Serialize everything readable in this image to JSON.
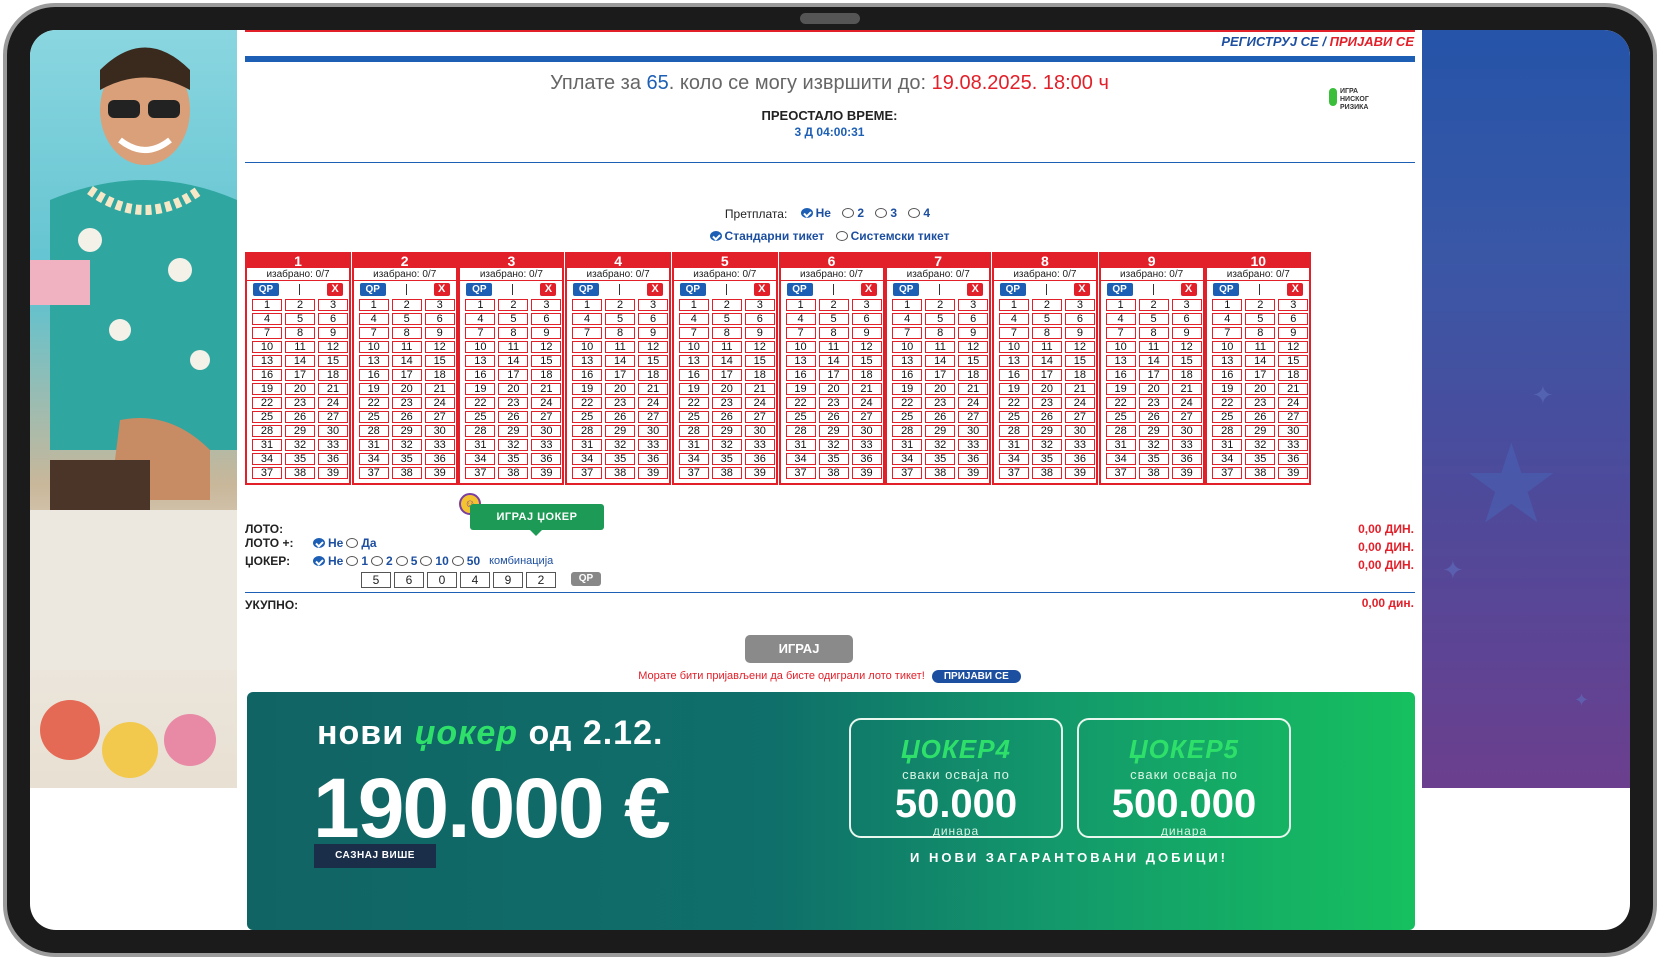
{
  "header": {
    "register_label": "РЕГИСТРУЈ СЕ",
    "separator": "/",
    "login_label": "ПРИЈАВИ СЕ"
  },
  "deadline": {
    "prefix": "Уплате за",
    "round": "65",
    "middle": ". коло се могу извршити до:",
    "datetime": "19.08.2025. 18:00 ч"
  },
  "remaining": {
    "label": "ПРЕОСТАЛО ВРЕМЕ:",
    "value": "3 Д 04:00:31"
  },
  "low_risk": {
    "line1": "ИГРА",
    "line2": "НИСКОГ",
    "line3": "РИЗИКА"
  },
  "subscription": {
    "label": "Претплата:",
    "options": [
      "Не",
      "2",
      "3",
      "4"
    ],
    "selected": "Не"
  },
  "ticket_type": {
    "options": [
      "Стандарни тикет",
      "Системски тикет"
    ],
    "selected": "Стандарни тикет"
  },
  "boards": {
    "selected_label": "изабрано: 0/7",
    "qp_label": "QP",
    "clear_label": "X",
    "titles": [
      "1",
      "2",
      "3",
      "4",
      "5",
      "6",
      "7",
      "8",
      "9",
      "10"
    ]
  },
  "joker_button": "ИГРАЈ ЏОКЕР",
  "summary": {
    "loto_label": "ЛОТО:",
    "loto_plus_label": "ЛОТО +:",
    "loto_plus_options": [
      "Не",
      "Да"
    ],
    "joker_label": "ЏОКЕР:",
    "joker_options": [
      "Не",
      "1",
      "2",
      "5",
      "10",
      "50"
    ],
    "joker_suffix": "комбинација",
    "joker_digits": [
      "5",
      "6",
      "0",
      "4",
      "9",
      "2"
    ],
    "joker_qp": "QP",
    "loto_amount": "0,00 ДИН.",
    "loto_plus_amount": "0,00 ДИН.",
    "joker_amount": "0,00 ДИН.",
    "total_label": "УКУПНО:",
    "total_amount": "0,00 дин."
  },
  "play_button": "ИГРАЈ",
  "login_message": "Морате бити пријављени да бисте одиграли лото тикет!",
  "login_button": "ПРИЈАВИ СЕ",
  "banner": {
    "new_prefix": "нови",
    "new_brand": "џокер",
    "new_suffix": "од 2.12.",
    "amount": "190.000 €",
    "more_button": "САЗНАЈ ВИШЕ",
    "box1_title": "ЏОКЕР4",
    "box1_sub": "сваки осваја по",
    "box1_value": "50.000",
    "box1_unit": "динара",
    "box2_title": "ЏОКЕР5",
    "box2_sub": "сваки осваја по",
    "box2_value": "500.000",
    "box2_unit": "динара",
    "footer": "И НОВИ ЗАГАРАНТОВАНИ ДОБИЦИ!"
  }
}
